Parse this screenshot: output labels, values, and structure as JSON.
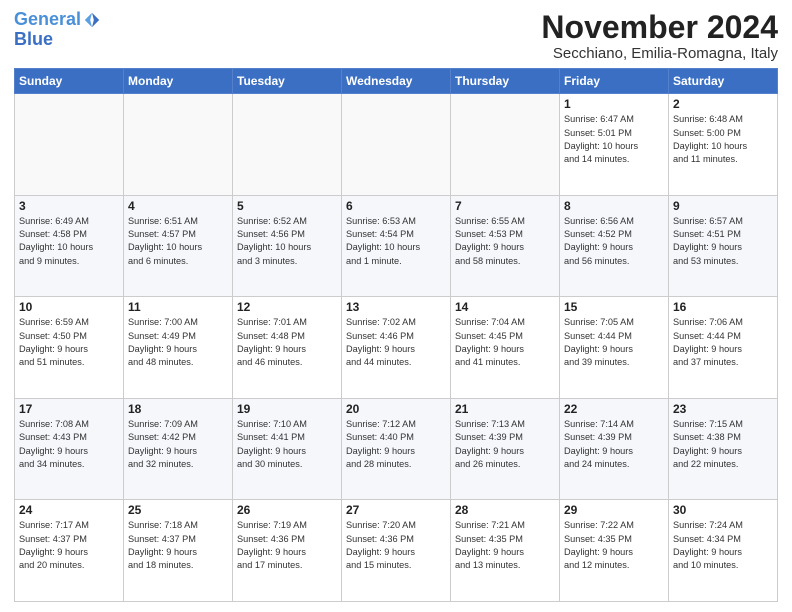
{
  "logo": {
    "line1": "General",
    "line2": "Blue"
  },
  "header": {
    "month_year": "November 2024",
    "location": "Secchiano, Emilia-Romagna, Italy"
  },
  "weekdays": [
    "Sunday",
    "Monday",
    "Tuesday",
    "Wednesday",
    "Thursday",
    "Friday",
    "Saturday"
  ],
  "weeks": [
    [
      {
        "day": "",
        "info": ""
      },
      {
        "day": "",
        "info": ""
      },
      {
        "day": "",
        "info": ""
      },
      {
        "day": "",
        "info": ""
      },
      {
        "day": "",
        "info": ""
      },
      {
        "day": "1",
        "info": "Sunrise: 6:47 AM\nSunset: 5:01 PM\nDaylight: 10 hours\nand 14 minutes."
      },
      {
        "day": "2",
        "info": "Sunrise: 6:48 AM\nSunset: 5:00 PM\nDaylight: 10 hours\nand 11 minutes."
      }
    ],
    [
      {
        "day": "3",
        "info": "Sunrise: 6:49 AM\nSunset: 4:58 PM\nDaylight: 10 hours\nand 9 minutes."
      },
      {
        "day": "4",
        "info": "Sunrise: 6:51 AM\nSunset: 4:57 PM\nDaylight: 10 hours\nand 6 minutes."
      },
      {
        "day": "5",
        "info": "Sunrise: 6:52 AM\nSunset: 4:56 PM\nDaylight: 10 hours\nand 3 minutes."
      },
      {
        "day": "6",
        "info": "Sunrise: 6:53 AM\nSunset: 4:54 PM\nDaylight: 10 hours\nand 1 minute."
      },
      {
        "day": "7",
        "info": "Sunrise: 6:55 AM\nSunset: 4:53 PM\nDaylight: 9 hours\nand 58 minutes."
      },
      {
        "day": "8",
        "info": "Sunrise: 6:56 AM\nSunset: 4:52 PM\nDaylight: 9 hours\nand 56 minutes."
      },
      {
        "day": "9",
        "info": "Sunrise: 6:57 AM\nSunset: 4:51 PM\nDaylight: 9 hours\nand 53 minutes."
      }
    ],
    [
      {
        "day": "10",
        "info": "Sunrise: 6:59 AM\nSunset: 4:50 PM\nDaylight: 9 hours\nand 51 minutes."
      },
      {
        "day": "11",
        "info": "Sunrise: 7:00 AM\nSunset: 4:49 PM\nDaylight: 9 hours\nand 48 minutes."
      },
      {
        "day": "12",
        "info": "Sunrise: 7:01 AM\nSunset: 4:48 PM\nDaylight: 9 hours\nand 46 minutes."
      },
      {
        "day": "13",
        "info": "Sunrise: 7:02 AM\nSunset: 4:46 PM\nDaylight: 9 hours\nand 44 minutes."
      },
      {
        "day": "14",
        "info": "Sunrise: 7:04 AM\nSunset: 4:45 PM\nDaylight: 9 hours\nand 41 minutes."
      },
      {
        "day": "15",
        "info": "Sunrise: 7:05 AM\nSunset: 4:44 PM\nDaylight: 9 hours\nand 39 minutes."
      },
      {
        "day": "16",
        "info": "Sunrise: 7:06 AM\nSunset: 4:44 PM\nDaylight: 9 hours\nand 37 minutes."
      }
    ],
    [
      {
        "day": "17",
        "info": "Sunrise: 7:08 AM\nSunset: 4:43 PM\nDaylight: 9 hours\nand 34 minutes."
      },
      {
        "day": "18",
        "info": "Sunrise: 7:09 AM\nSunset: 4:42 PM\nDaylight: 9 hours\nand 32 minutes."
      },
      {
        "day": "19",
        "info": "Sunrise: 7:10 AM\nSunset: 4:41 PM\nDaylight: 9 hours\nand 30 minutes."
      },
      {
        "day": "20",
        "info": "Sunrise: 7:12 AM\nSunset: 4:40 PM\nDaylight: 9 hours\nand 28 minutes."
      },
      {
        "day": "21",
        "info": "Sunrise: 7:13 AM\nSunset: 4:39 PM\nDaylight: 9 hours\nand 26 minutes."
      },
      {
        "day": "22",
        "info": "Sunrise: 7:14 AM\nSunset: 4:39 PM\nDaylight: 9 hours\nand 24 minutes."
      },
      {
        "day": "23",
        "info": "Sunrise: 7:15 AM\nSunset: 4:38 PM\nDaylight: 9 hours\nand 22 minutes."
      }
    ],
    [
      {
        "day": "24",
        "info": "Sunrise: 7:17 AM\nSunset: 4:37 PM\nDaylight: 9 hours\nand 20 minutes."
      },
      {
        "day": "25",
        "info": "Sunrise: 7:18 AM\nSunset: 4:37 PM\nDaylight: 9 hours\nand 18 minutes."
      },
      {
        "day": "26",
        "info": "Sunrise: 7:19 AM\nSunset: 4:36 PM\nDaylight: 9 hours\nand 17 minutes."
      },
      {
        "day": "27",
        "info": "Sunrise: 7:20 AM\nSunset: 4:36 PM\nDaylight: 9 hours\nand 15 minutes."
      },
      {
        "day": "28",
        "info": "Sunrise: 7:21 AM\nSunset: 4:35 PM\nDaylight: 9 hours\nand 13 minutes."
      },
      {
        "day": "29",
        "info": "Sunrise: 7:22 AM\nSunset: 4:35 PM\nDaylight: 9 hours\nand 12 minutes."
      },
      {
        "day": "30",
        "info": "Sunrise: 7:24 AM\nSunset: 4:34 PM\nDaylight: 9 hours\nand 10 minutes."
      }
    ]
  ]
}
